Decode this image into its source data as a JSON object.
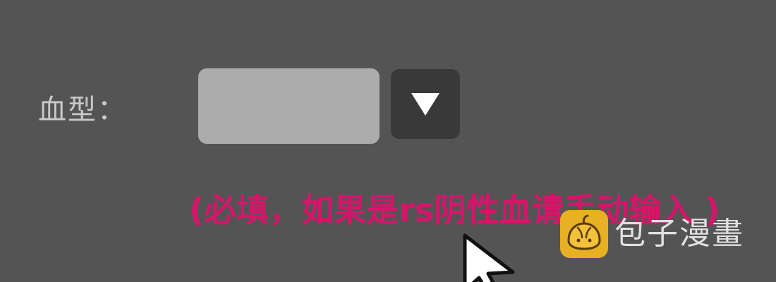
{
  "form": {
    "blood_type_label": "血型：",
    "blood_type_value": "",
    "blood_type_placeholder": "",
    "hint": "(必填，如果是rs阴性血请手动输入 )"
  },
  "watermark": {
    "text": "包子漫畫",
    "logo_icon": "bun-logo-icon"
  },
  "icons": {
    "dropdown": "triangle-down-icon",
    "cursor": "mouse-pointer-icon"
  },
  "colors": {
    "background": "#545454",
    "input_fill": "#acacac",
    "dropdown_fill": "#393939",
    "label_text": "#c9c9c9",
    "hint_text": "#d4166b",
    "watermark_logo": "#e8b023"
  }
}
